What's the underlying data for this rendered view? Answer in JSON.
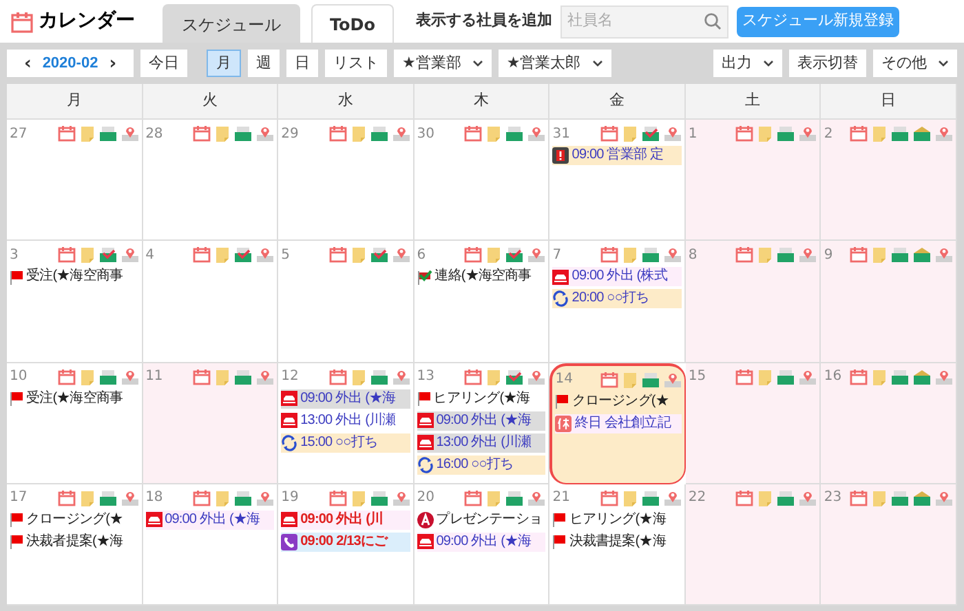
{
  "app": {
    "title": "カレンダー"
  },
  "tabs": [
    {
      "label": "スケジュール",
      "selected": true
    },
    {
      "label": "ToDo",
      "selected": false
    }
  ],
  "employee_search": {
    "label": "表示する社員を追加",
    "placeholder": "社員名"
  },
  "new_button": "スケジュール新規登録",
  "toolbar": {
    "prev": "‹",
    "month": "2020-02",
    "next": "›",
    "today": "今日",
    "views": [
      {
        "label": "月",
        "selected": true
      },
      {
        "label": "週",
        "selected": false
      },
      {
        "label": "日",
        "selected": false
      },
      {
        "label": "リスト",
        "selected": false
      }
    ],
    "dropdowns": [
      "★営業部",
      "★営業太郎"
    ],
    "right_buttons": [
      {
        "label": "出力",
        "kind": "dropdown"
      },
      {
        "label": "表示切替",
        "kind": "button"
      },
      {
        "label": "その他",
        "kind": "dropdown"
      }
    ]
  },
  "weekdays": [
    "月",
    "火",
    "水",
    "木",
    "金",
    "土",
    "日"
  ],
  "weeks": [
    [
      {
        "day": "27",
        "off": false,
        "today": false,
        "mail_checked": false,
        "extra_mail": false
      },
      {
        "day": "28",
        "off": false,
        "today": false,
        "mail_checked": false,
        "extra_mail": false
      },
      {
        "day": "29",
        "off": false,
        "today": false,
        "mail_checked": false,
        "extra_mail": false
      },
      {
        "day": "30",
        "off": false,
        "today": false,
        "mail_checked": false,
        "extra_mail": false
      },
      {
        "day": "31",
        "off": false,
        "today": false,
        "mail_checked": true,
        "extra_mail": false,
        "events": [
          {
            "kind": "alarm",
            "text": "09:00 営業部 定",
            "color": "#fdebc8",
            "emphasis": false
          }
        ]
      },
      {
        "day": "1",
        "off": true,
        "today": false,
        "mail_checked": false,
        "extra_mail": false
      },
      {
        "day": "2",
        "off": true,
        "today": false,
        "mail_checked": false,
        "extra_mail": true
      }
    ],
    [
      {
        "day": "3",
        "off": false,
        "today": false,
        "mail_checked": true,
        "extra_mail": false,
        "events": [
          {
            "kind": "flag",
            "text": "受注(★海空商事",
            "color": "#ffffff",
            "emphasis": false
          }
        ]
      },
      {
        "day": "4",
        "off": false,
        "today": false,
        "mail_checked": true,
        "extra_mail": false
      },
      {
        "day": "5",
        "off": false,
        "today": false,
        "mail_checked": true,
        "extra_mail": false
      },
      {
        "day": "6",
        "off": false,
        "today": false,
        "mail_checked": true,
        "extra_mail": false,
        "events": [
          {
            "kind": "contact",
            "text": "連絡(★海空商事",
            "color": "#ffffff",
            "emphasis": false
          }
        ]
      },
      {
        "day": "7",
        "off": false,
        "today": false,
        "mail_checked": false,
        "extra_mail": false,
        "events": [
          {
            "kind": "outing",
            "text": "09:00 外出 (株式",
            "color": "#fdeefa",
            "emphasis": false
          },
          {
            "kind": "repeat",
            "text": "20:00 ○○打ち",
            "color": "#fdebc8",
            "emphasis": false
          }
        ]
      },
      {
        "day": "8",
        "off": true,
        "today": false,
        "mail_checked": false,
        "extra_mail": false
      },
      {
        "day": "9",
        "off": true,
        "today": false,
        "mail_checked": false,
        "extra_mail": true
      }
    ],
    [
      {
        "day": "10",
        "off": false,
        "today": false,
        "mail_checked": false,
        "extra_mail": false,
        "events": [
          {
            "kind": "flag",
            "text": "受注(★海空商事",
            "color": "#ffffff",
            "emphasis": false
          }
        ]
      },
      {
        "day": "11",
        "off": true,
        "today": false,
        "mail_checked": false,
        "extra_mail": false
      },
      {
        "day": "12",
        "off": false,
        "today": false,
        "mail_checked": false,
        "extra_mail": false,
        "events": [
          {
            "kind": "outing",
            "text": "09:00 外出 (★海",
            "color": "#dcdcdc",
            "emphasis": false
          },
          {
            "kind": "outing",
            "text": "13:00 外出 (川瀬",
            "color": "#ffffff",
            "emphasis": false
          },
          {
            "kind": "repeat",
            "text": "15:00 ○○打ち",
            "color": "#fdebc8",
            "emphasis": false
          }
        ]
      },
      {
        "day": "13",
        "off": false,
        "today": false,
        "mail_checked": true,
        "extra_mail": false,
        "events": [
          {
            "kind": "flag",
            "text": "ヒアリング(★海",
            "color": "#ffffff",
            "emphasis": false
          },
          {
            "kind": "outing",
            "text": "09:00 外出 (★海",
            "color": "#dcdcdc",
            "emphasis": false
          },
          {
            "kind": "outing",
            "text": "13:00 外出 (川瀬",
            "color": "#dcdcdc",
            "emphasis": false
          },
          {
            "kind": "repeat",
            "text": "16:00 ○○打ち",
            "color": "#fdebc8",
            "emphasis": false
          }
        ]
      },
      {
        "day": "14",
        "off": false,
        "today": true,
        "mail_checked": false,
        "extra_mail": false,
        "events": [
          {
            "kind": "flag",
            "text": "クロージング(★",
            "color": "#fdebc8",
            "emphasis": false
          },
          {
            "kind": "holiday",
            "text": "終日 会社創立記",
            "color": "#fdeefa",
            "emphasis": false
          }
        ]
      },
      {
        "day": "15",
        "off": true,
        "today": false,
        "mail_checked": false,
        "extra_mail": false
      },
      {
        "day": "16",
        "off": true,
        "today": false,
        "mail_checked": false,
        "extra_mail": true
      }
    ],
    [
      {
        "day": "17",
        "off": false,
        "today": false,
        "mail_checked": false,
        "extra_mail": false,
        "events": [
          {
            "kind": "flag",
            "text": "クロージング(★",
            "color": "#ffffff",
            "emphasis": false
          },
          {
            "kind": "flag",
            "text": "決裁者提案(★海",
            "color": "#ffffff",
            "emphasis": false
          }
        ]
      },
      {
        "day": "18",
        "off": false,
        "today": false,
        "mail_checked": false,
        "extra_mail": false,
        "events": [
          {
            "kind": "outing",
            "text": "09:00 外出 (★海",
            "color": "#fdeefa",
            "emphasis": false
          }
        ]
      },
      {
        "day": "19",
        "off": false,
        "today": false,
        "mail_checked": false,
        "extra_mail": false,
        "events": [
          {
            "kind": "outing",
            "text": "09:00 外出 (川",
            "color": "#fdeefa",
            "emphasis": true
          },
          {
            "kind": "phone",
            "text": "09:00 2/13にご",
            "color": "#dbeefb",
            "emphasis": true
          }
        ]
      },
      {
        "day": "20",
        "off": false,
        "today": false,
        "mail_checked": false,
        "extra_mail": false,
        "events": [
          {
            "kind": "presentation",
            "text": "プレゼンテーショ",
            "color": "#ffffff",
            "emphasis": false
          },
          {
            "kind": "outing",
            "text": "09:00 外出 (★海",
            "color": "#fdeefa",
            "emphasis": false
          }
        ]
      },
      {
        "day": "21",
        "off": false,
        "today": false,
        "mail_checked": false,
        "extra_mail": false,
        "events": [
          {
            "kind": "flag",
            "text": "ヒアリング(★海",
            "color": "#ffffff",
            "emphasis": false
          },
          {
            "kind": "flag",
            "text": "決裁書提案(★海",
            "color": "#ffffff",
            "emphasis": false
          }
        ]
      },
      {
        "day": "22",
        "off": true,
        "today": false,
        "mail_checked": false,
        "extra_mail": false
      },
      {
        "day": "23",
        "off": true,
        "today": false,
        "mail_checked": false,
        "extra_mail": true
      }
    ]
  ]
}
